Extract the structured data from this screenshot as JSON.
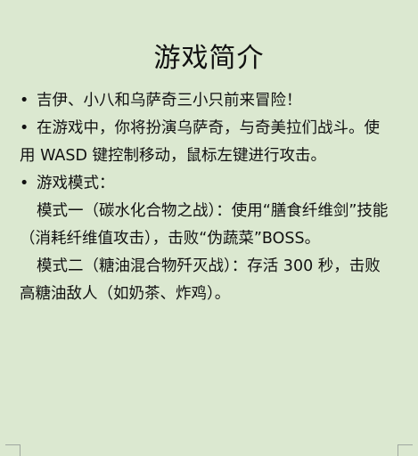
{
  "title": "游戏简介",
  "bullet_symbol": "•",
  "bullets": [
    {
      "text": "吉伊、小八和乌萨奇三小只前来冒险！"
    },
    {
      "text": "在游戏中，你将扮演乌萨奇，与奇美拉们战斗。使用 WASD 键控制移动，鼠标左键进行攻击。"
    },
    {
      "text": "游戏模式："
    }
  ],
  "modes": [
    {
      "text": "模式一（碳水化合物之战）：使用“膳食纤维剑”技能（消耗纤维值攻击），击败“伪蔬菜”BOSS。"
    },
    {
      "text": "模式二（糖油混合物歼灭战）：存活 300 秒，击败高糖油敌人（如奶茶、炸鸡）。"
    }
  ]
}
